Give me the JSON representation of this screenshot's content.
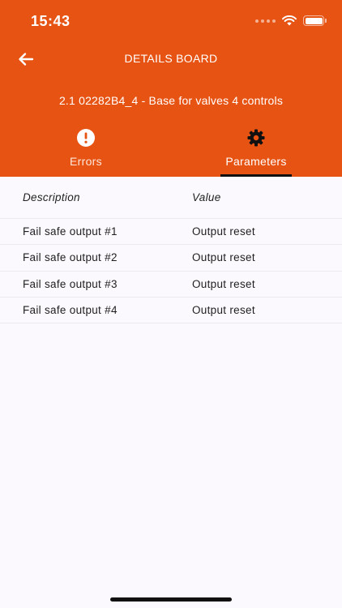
{
  "status_bar": {
    "time": "15:43",
    "battery_level": 1.0
  },
  "header": {
    "title": "DETAILS BOARD",
    "subtitle": "2.1 02282B4_4 - Base for valves 4 controls",
    "back_icon": "arrow-left-icon"
  },
  "tabs": [
    {
      "label": "Errors",
      "icon": "alert-circle-icon",
      "selected": false
    },
    {
      "label": "Parameters",
      "icon": "gear-icon",
      "selected": true
    }
  ],
  "table": {
    "columns": [
      "Description",
      "Value"
    ],
    "rows": [
      {
        "description": "Fail safe output #1",
        "value": "Output reset"
      },
      {
        "description": "Fail safe output #2",
        "value": "Output reset"
      },
      {
        "description": "Fail safe output #3",
        "value": "Output reset"
      },
      {
        "description": "Fail safe output #4",
        "value": "Output reset"
      }
    ]
  },
  "colors": {
    "accent": "#e75313",
    "background": "#fbf9fd",
    "tab_indicator": "#111111"
  }
}
